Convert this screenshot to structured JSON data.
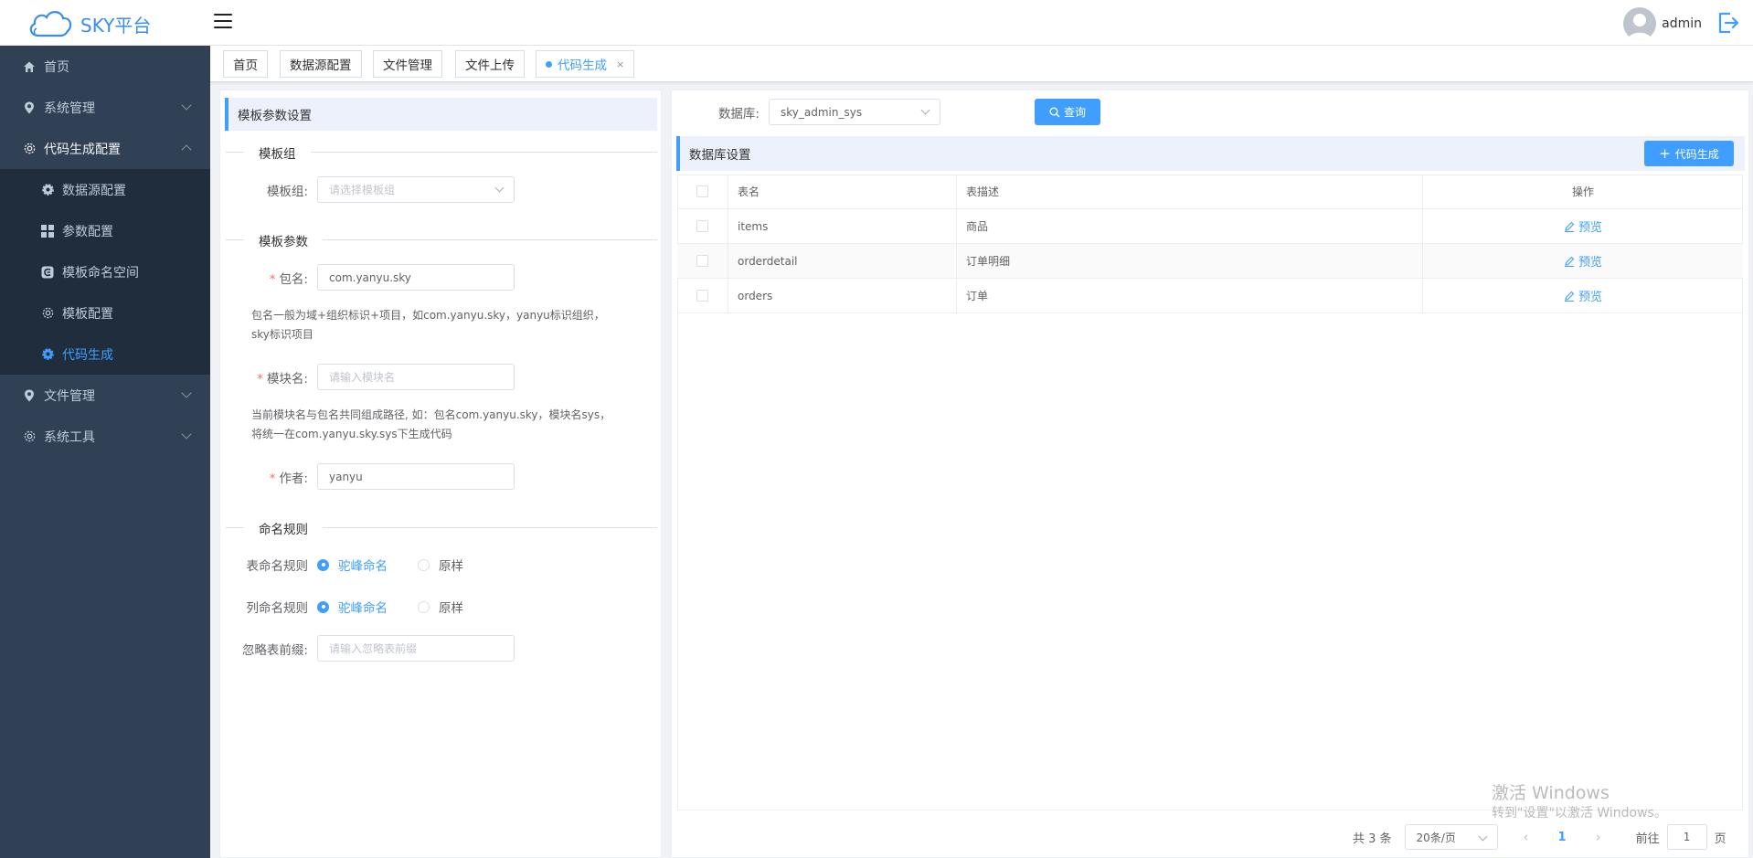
{
  "app": {
    "logo_text": "SKY平台",
    "username": "admin"
  },
  "sidebar": {
    "items": [
      {
        "label": "首页"
      },
      {
        "label": "系统管理"
      },
      {
        "label": "代码生成配置"
      },
      {
        "label": "文件管理"
      },
      {
        "label": "系统工具"
      }
    ],
    "submenu": [
      {
        "label": "数据源配置"
      },
      {
        "label": "参数配置"
      },
      {
        "label": "模板命名空间"
      },
      {
        "label": "模板配置"
      },
      {
        "label": "代码生成"
      }
    ]
  },
  "tabs": [
    {
      "label": "首页"
    },
    {
      "label": "数据源配置"
    },
    {
      "label": "文件管理"
    },
    {
      "label": "文件上传"
    },
    {
      "label": "代码生成",
      "close": "×"
    }
  ],
  "left": {
    "title": "模板参数设置",
    "group_section": "模板组",
    "group_label": "模板组:",
    "group_placeholder": "请选择模板组",
    "params_section": "模板参数",
    "package_label": "包名:",
    "package_value": "com.yanyu.sky",
    "package_help": "包名一般为域+组织标识+项目，如com.yanyu.sky，yanyu标识组织，sky标识项目",
    "module_label": "模块名:",
    "module_placeholder": "请输入模块名",
    "module_help": "当前模块名与包名共同组成路径, 如：包名com.yanyu.sky，模块名sys，将统一在com.yanyu.sky.sys下生成代码",
    "author_label": "作者:",
    "author_value": "yanyu",
    "required_mark": "*",
    "naming_section": "命名规则",
    "table_rule_label": "表命名规则",
    "column_rule_label": "列命名规则",
    "camel_option": "驼峰命名",
    "original_option": "原样",
    "prefix_label": "忽略表前缀:",
    "prefix_placeholder": "请输入忽略表前缀"
  },
  "right": {
    "db_label": "数据库:",
    "db_value": "sky_admin_sys",
    "query_button": "查询",
    "section_title": "数据库设置",
    "generate_button": "代码生成",
    "columns": [
      "表名",
      "表描述",
      "操作"
    ],
    "rows": [
      {
        "name": "items",
        "desc": "商品",
        "action": "预览"
      },
      {
        "name": "orderdetail",
        "desc": "订单明细",
        "action": "预览"
      },
      {
        "name": "orders",
        "desc": "订单",
        "action": "预览"
      }
    ],
    "pagination": {
      "total": "共 3 条",
      "page_size": "20条/页",
      "current_page": "1",
      "goto_label": "前往",
      "goto_value": "1",
      "page_suffix": "页"
    }
  },
  "watermark": {
    "line1": "激活 Windows",
    "line2": "转到\"设置\"以激活 Windows。"
  },
  "colors": {
    "primary": "#409eff",
    "sidebar_bg": "#304156",
    "submenu_bg": "#1f2d3d",
    "required": "#f56c6c"
  }
}
